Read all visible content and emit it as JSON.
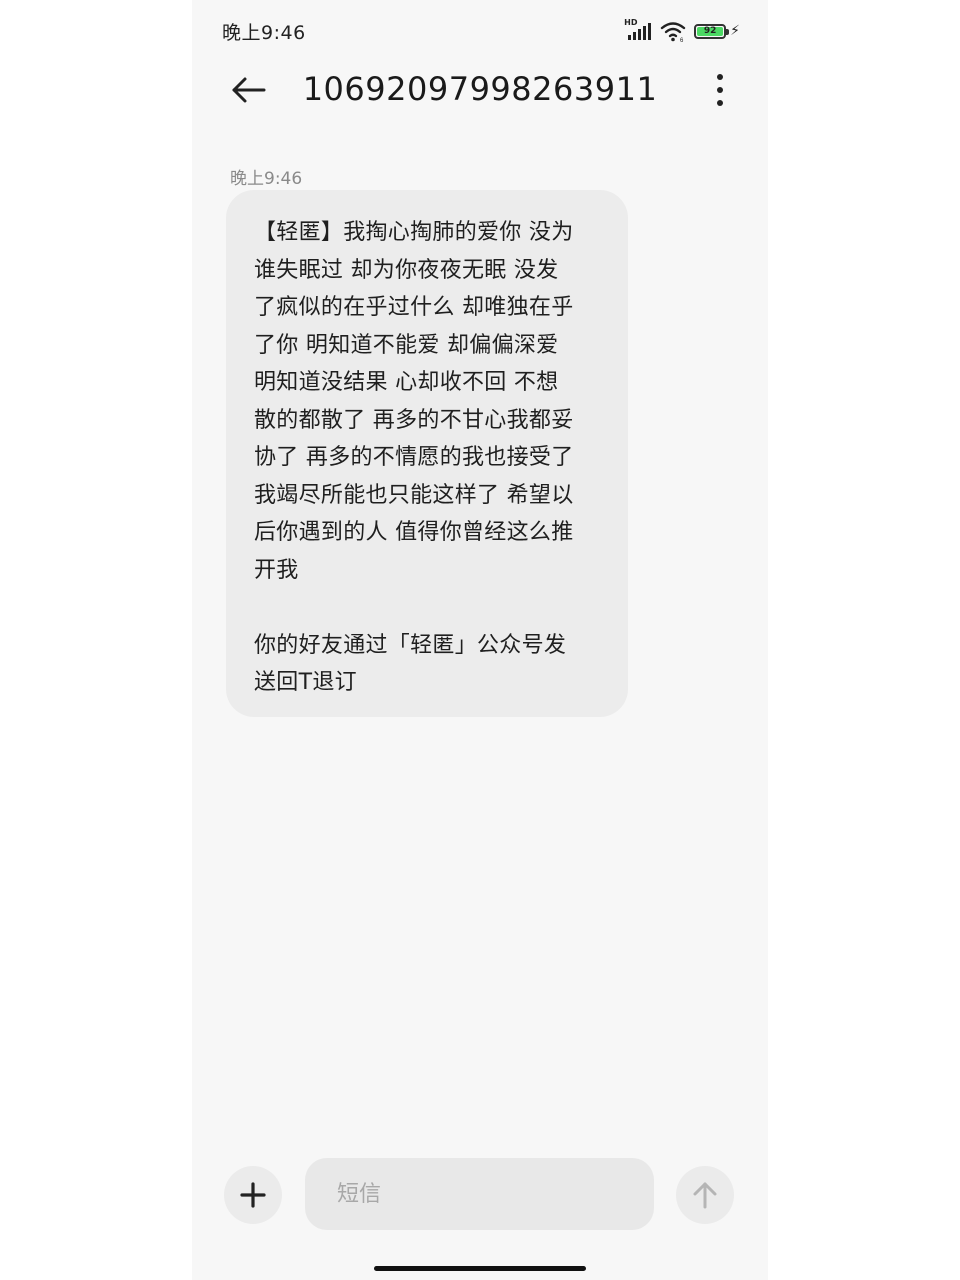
{
  "status_bar": {
    "time": "晚上9:46",
    "network_label": "HD",
    "battery_level": "92"
  },
  "header": {
    "title": "10692097998263911"
  },
  "message": {
    "time": "晚上9:46",
    "body": "【轻匿】我掏心掏肺的爱你  没为\n谁失眠过  却为你夜夜无眠  没发\n了疯似的在乎过什么  却唯独在乎\n了你  明知道不能爱  却偏偏深爱\n明知道没结果  心却收不回  不想\n散的都散了  再多的不甘心我都妥\n协了  再多的不情愿的我也接受了\n我竭尽所能也只能这样了  希望以\n后你遇到的人  值得你曾经这么推\n开我\n\n你的好友通过「轻匿」公众号发\n送回T退订"
  },
  "input": {
    "placeholder": "短信",
    "value": ""
  },
  "icons": {
    "back": "back-arrow-icon",
    "more": "more-vertical-icon",
    "add": "plus-icon",
    "send": "arrow-up-icon",
    "wifi": "wifi-icon",
    "signal": "signal-icon",
    "battery": "battery-icon",
    "charging": "bolt-icon"
  },
  "colors": {
    "battery_fill": "#4cd964",
    "bubble": "#ececec",
    "background": "#f7f7f7"
  }
}
